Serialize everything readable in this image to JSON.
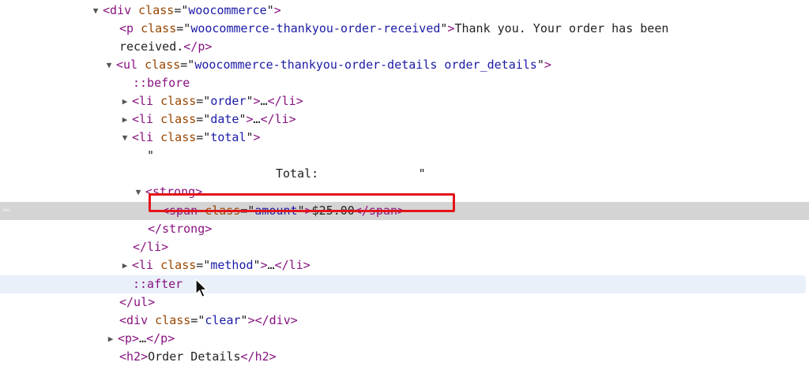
{
  "dom_tree": {
    "lines": [
      {
        "indent": 130,
        "twisty": "open",
        "parts": [
          [
            "t",
            "<div "
          ],
          [
            "a",
            "class"
          ],
          [
            "x",
            "=\""
          ],
          [
            "v",
            "woocommerce"
          ],
          [
            "x",
            "\""
          ],
          [
            "t",
            ">"
          ]
        ]
      },
      {
        "indent": 151,
        "twisty": "",
        "parts": [
          [
            "t",
            "<p "
          ],
          [
            "a",
            "class"
          ],
          [
            "x",
            "=\""
          ],
          [
            "v",
            "woocommerce-thankyou-order-received"
          ],
          [
            "x",
            "\""
          ],
          [
            "t",
            ">"
          ],
          [
            "x",
            "Thank you. Your order has been"
          ]
        ]
      },
      {
        "indent": 151,
        "twisty": "",
        "parts": [
          [
            "x",
            "received."
          ],
          [
            "t",
            "</p>"
          ]
        ]
      },
      {
        "indent": 147,
        "twisty": "open",
        "parts": [
          [
            "t",
            "<ul "
          ],
          [
            "a",
            "class"
          ],
          [
            "x",
            "=\""
          ],
          [
            "v",
            "woocommerce-thankyou-order-details order_details"
          ],
          [
            "x",
            "\""
          ],
          [
            "t",
            ">"
          ]
        ]
      },
      {
        "indent": 168,
        "twisty": "",
        "parts": [
          [
            "t",
            "::before"
          ]
        ]
      },
      {
        "indent": 167,
        "twisty": "closed",
        "parts": [
          [
            "t",
            "<li "
          ],
          [
            "a",
            "class"
          ],
          [
            "x",
            "=\""
          ],
          [
            "v",
            "order"
          ],
          [
            "x",
            "\""
          ],
          [
            "t",
            ">"
          ],
          [
            "x",
            "…"
          ],
          [
            "t",
            "</li>"
          ]
        ]
      },
      {
        "indent": 167,
        "twisty": "closed",
        "parts": [
          [
            "t",
            "<li "
          ],
          [
            "a",
            "class"
          ],
          [
            "x",
            "=\""
          ],
          [
            "v",
            "date"
          ],
          [
            "x",
            "\""
          ],
          [
            "t",
            ">"
          ],
          [
            "x",
            "…"
          ],
          [
            "t",
            "</li>"
          ]
        ]
      },
      {
        "indent": 167,
        "twisty": "open",
        "parts": [
          [
            "t",
            "<li "
          ],
          [
            "a",
            "class"
          ],
          [
            "x",
            "=\""
          ],
          [
            "v",
            "total"
          ],
          [
            "x",
            "\""
          ],
          [
            "t",
            ">"
          ]
        ]
      },
      {
        "indent": 186,
        "twisty": "",
        "parts": [
          [
            "x",
            "\""
          ]
        ]
      },
      {
        "indent": 349,
        "twisty": "",
        "parts": [
          [
            "x",
            "Total:              \""
          ]
        ]
      },
      {
        "indent": 184,
        "twisty": "open",
        "parts": [
          [
            "t",
            "<strong>"
          ]
        ]
      },
      {
        "indent": 205,
        "twisty": "",
        "parts": [
          [
            "t",
            "<span "
          ],
          [
            "a",
            "class"
          ],
          [
            "x",
            "=\""
          ],
          [
            "v",
            "amount"
          ],
          [
            "x",
            "\""
          ],
          [
            "t",
            ">"
          ],
          [
            "x",
            "$25.00"
          ],
          [
            "t",
            "</span>"
          ]
        ],
        "selected": true
      },
      {
        "indent": 187,
        "twisty": "",
        "parts": [
          [
            "t",
            "</strong>"
          ]
        ]
      },
      {
        "indent": 168,
        "twisty": "",
        "parts": [
          [
            "t",
            "</li>"
          ]
        ]
      },
      {
        "indent": 167,
        "twisty": "closed",
        "parts": [
          [
            "t",
            "<li "
          ],
          [
            "a",
            "class"
          ],
          [
            "x",
            "=\""
          ],
          [
            "v",
            "method"
          ],
          [
            "x",
            "\""
          ],
          [
            "t",
            ">"
          ],
          [
            "x",
            "…"
          ],
          [
            "t",
            "</li>"
          ]
        ]
      },
      {
        "indent": 168,
        "twisty": "",
        "parts": [
          [
            "t",
            "::after"
          ]
        ],
        "hover": true
      },
      {
        "indent": 151,
        "twisty": "",
        "parts": [
          [
            "t",
            "</ul>"
          ]
        ]
      },
      {
        "indent": 151,
        "twisty": "",
        "parts": [
          [
            "t",
            "<div "
          ],
          [
            "a",
            "class"
          ],
          [
            "x",
            "=\""
          ],
          [
            "v",
            "clear"
          ],
          [
            "x",
            "\""
          ],
          [
            "t",
            "></div>"
          ]
        ]
      },
      {
        "indent": 149,
        "twisty": "closed",
        "parts": [
          [
            "t",
            "<p>"
          ],
          [
            "x",
            "…"
          ],
          [
            "t",
            "</p>"
          ]
        ]
      },
      {
        "indent": 151,
        "twisty": "",
        "parts": [
          [
            "t",
            "<h2>"
          ],
          [
            "x",
            "Order Details"
          ],
          [
            "t",
            "</h2>"
          ]
        ]
      }
    ],
    "selected_gutter": "==  "
  },
  "colors": {
    "tag": "#881280",
    "attr_name": "#994500",
    "attr_value": "#1a1aa6",
    "text": "#222222",
    "selected_row": "#d4d4d4",
    "hover_row": "#e9f0fa",
    "highlight_box": "#e3151a"
  },
  "icons": {
    "twisty_open": "triangle-down-icon",
    "twisty_closed": "triangle-right-icon",
    "cursor": "mouse-pointer-icon"
  }
}
